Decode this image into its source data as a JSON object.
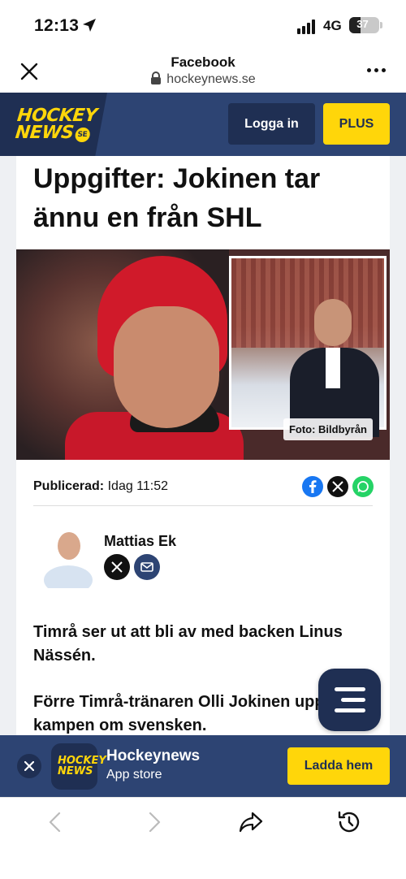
{
  "status_bar": {
    "time": "12:13",
    "network": "4G",
    "battery": "37",
    "battery_level": 0.37
  },
  "browser": {
    "title": "Facebook",
    "url": "hockeynews.se"
  },
  "site": {
    "logo_line1": "HOCKEY",
    "logo_line2": "NEWS",
    "logo_se": "SE",
    "login_label": "Logga in",
    "plus_label": "PLUS",
    "brand_color": "#2d4473",
    "accent_color": "#ffd60a"
  },
  "article": {
    "headline": "Uppgifter: Jokinen tar ännu en från SHL",
    "photo_credit": "Foto: Bildbyrån",
    "published_label": "Publicerad:",
    "published_value": "Idag 11:52",
    "author": "Mattias Ek",
    "paragraphs": [
      "Timrå ser ut att bli av med backen Linus Nässén.",
      "Förre Timrå-tränaren Olli Jokinen upp vinna kampen om svensken."
    ],
    "share_icons": [
      "facebook-icon",
      "x-icon",
      "whatsapp-icon"
    ]
  },
  "app_banner": {
    "name": "Hockeynews",
    "store": "App store",
    "cta": "Ladda hem"
  }
}
